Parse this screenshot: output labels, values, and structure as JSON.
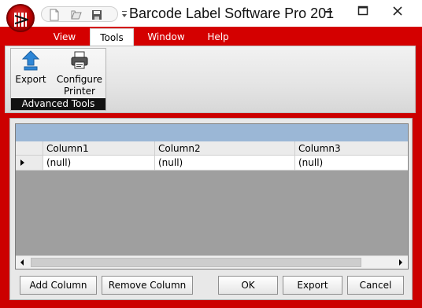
{
  "window": {
    "title": "Barcode Label Software Pro 201",
    "minimize_icon": "minimize-icon",
    "maximize_icon": "maximize-icon",
    "close_icon": "close-icon"
  },
  "quick_access": [
    "new-file-icon",
    "open-icon",
    "save-icon"
  ],
  "tabs": [
    {
      "label": "View",
      "active": false
    },
    {
      "label": "Tools",
      "active": true
    },
    {
      "label": "Window",
      "active": false
    },
    {
      "label": "Help",
      "active": false
    }
  ],
  "ribbon": {
    "group_label": "Advanced Tools",
    "buttons": [
      {
        "line1": "Export",
        "line2": "",
        "icon": "export-arrow-icon"
      },
      {
        "line1": "Configure",
        "line2": "Printer",
        "icon": "printer-icon"
      }
    ]
  },
  "grid": {
    "columns": [
      "Column1",
      "Column2",
      "Column3"
    ],
    "rows": [
      [
        "(null)",
        "(null)",
        "(null)"
      ]
    ]
  },
  "buttons": {
    "add_column": "Add Column",
    "remove_column": "Remove Column",
    "ok": "OK",
    "export": "Export",
    "cancel": "Cancel"
  },
  "colors": {
    "frame_red": "#cc0000",
    "grid_caption": "#9bb7d6",
    "grid_background": "#9f9f9f"
  }
}
